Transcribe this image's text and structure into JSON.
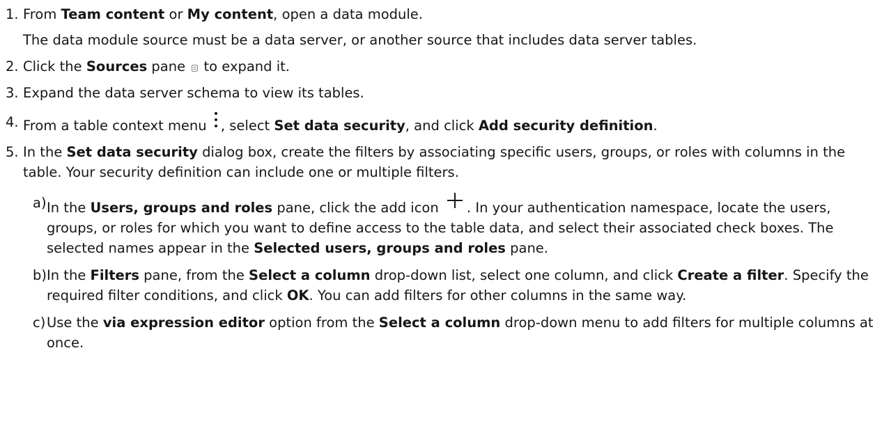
{
  "steps": [
    {
      "num": "1.",
      "parts": [
        "From ",
        "Team content",
        " or ",
        "My content",
        ", open a data module."
      ],
      "info": "The data module source must be a data server, or another source that includes data server tables."
    },
    {
      "num": "2.",
      "parts": [
        "Click the ",
        "Sources",
        " pane ",
        " to expand it."
      ],
      "icon": "sources-pane-icon"
    },
    {
      "num": "3.",
      "parts": [
        "Expand the data server schema to view its tables."
      ]
    },
    {
      "num": "4.",
      "parts": [
        "From a table context menu ",
        ", select ",
        "Set data security",
        ", and click ",
        "Add security definition",
        "."
      ],
      "icon": "kebab-menu-icon"
    },
    {
      "num": "5.",
      "parts": [
        "In the ",
        "Set data security",
        " dialog box, create the filters by associating specific users, groups, or roles with columns in the table. Your security definition can include one or multiple filters."
      ],
      "substeps": [
        {
          "letter": "a)",
          "parts": [
            "In the ",
            "Users, groups and roles",
            " pane, click the add icon ",
            ". In your authentication namespace, locate the users, groups, or roles for which you want to define access to the table data, and select their associated check boxes. The selected names appear in the ",
            "Selected users, groups and roles",
            " pane."
          ],
          "icon": "plus-icon"
        },
        {
          "letter": "b)",
          "parts": [
            "In the ",
            "Filters",
            " pane, from the ",
            "Select a column",
            " drop-down list, select one column, and click ",
            "Create a filter",
            ". Specify the required filter conditions, and click ",
            "OK",
            ". You can add filters for other columns in the same way."
          ]
        },
        {
          "letter": "c)",
          "parts": [
            "Use the ",
            "via expression editor",
            " option from the ",
            "Select a column",
            " drop-down menu to add filters for multiple columns at once."
          ]
        }
      ]
    }
  ]
}
